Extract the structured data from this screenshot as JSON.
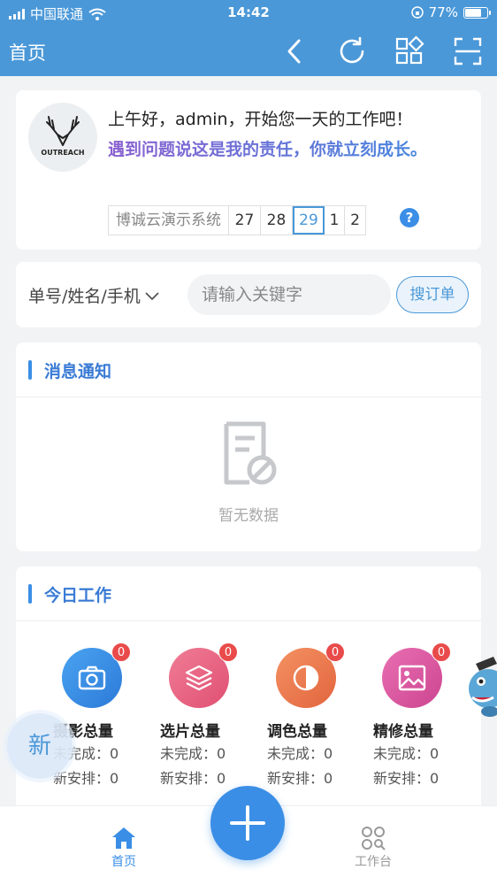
{
  "status_bar": {
    "carrier": "中国联通",
    "time": "14:42",
    "battery": "77%",
    "battery_level": 0.77
  },
  "nav": {
    "title": "首页"
  },
  "greeting": {
    "logo_text": "OUTREACH",
    "line1": "上午好，admin，开始您一天的工作吧！",
    "motto": "遇到问题说这是我的责任，你就立刻成长。",
    "system_name": "博诚云演示系统",
    "days": [
      "27",
      "28",
      "29",
      "1",
      "2"
    ],
    "active_day": "29",
    "help_glyph": "?"
  },
  "search": {
    "filter_label": "单号/姓名/手机",
    "placeholder": "请输入关键字",
    "button": "搜订单"
  },
  "notice": {
    "title": "消息通知",
    "empty_text": "暂无数据"
  },
  "work": {
    "title": "今日工作",
    "stats": [
      {
        "name": "摄影总量",
        "badge": "0",
        "line1": "未完成：0",
        "line2": "新安排：0",
        "icon": "camera-icon",
        "color": "#3a8ee6"
      },
      {
        "name": "选片总量",
        "badge": "0",
        "line1": "未完成：0",
        "line2": "新安排：0",
        "icon": "layers-icon",
        "color": "#e8607e"
      },
      {
        "name": "调色总量",
        "badge": "0",
        "line1": "未完成：0",
        "line2": "新安排：0",
        "icon": "contrast-icon",
        "color": "#ec7a50"
      },
      {
        "name": "精修总量",
        "badge": "0",
        "line1": "未完成：0",
        "line2": "新安排：0",
        "icon": "image-icon",
        "color": "#d9559c"
      }
    ]
  },
  "fab_new": "新",
  "tabbar": {
    "home": "首页",
    "workbench": "工作台"
  }
}
